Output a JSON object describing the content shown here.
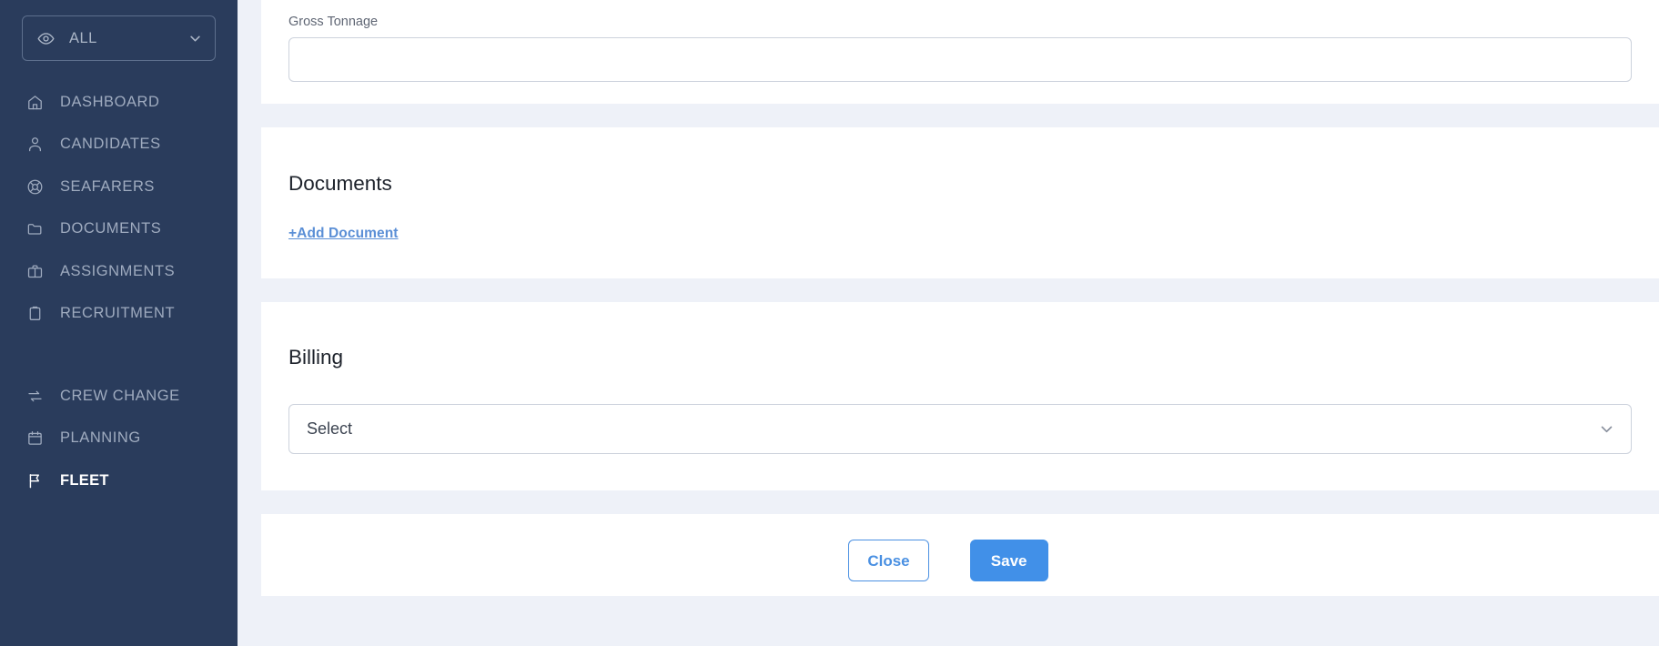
{
  "colors": {
    "sidebar_bg": "#2a3c5c",
    "page_bg": "#eef1f8",
    "card_bg": "#ffffff",
    "accent_blue": "#4190e8",
    "link_blue": "#5b8fd6",
    "sidebar_text": "#9fabbf",
    "sidebar_text_active": "#ffffff",
    "input_border": "#ccd2dc"
  },
  "sidebar": {
    "org_selector": {
      "icon": "eye-icon",
      "value": "ALL",
      "chevron": "chevron-down-icon"
    },
    "items": [
      {
        "label": "DASHBOARD",
        "icon": "home-icon",
        "active": false
      },
      {
        "label": "CANDIDATES",
        "icon": "user-icon",
        "active": false
      },
      {
        "label": "SEAFARERS",
        "icon": "lifebuoy-icon",
        "active": false
      },
      {
        "label": "DOCUMENTS",
        "icon": "folder-icon",
        "active": false
      },
      {
        "label": "ASSIGNMENTS",
        "icon": "briefcase-icon",
        "active": false
      },
      {
        "label": "RECRUITMENT",
        "icon": "clipboard-icon",
        "active": false
      },
      {
        "label": "CREW CHANGE",
        "icon": "exchange-icon",
        "active": false
      },
      {
        "label": "PLANNING",
        "icon": "calendar-icon",
        "active": false
      },
      {
        "label": "FLEET",
        "icon": "flag-icon",
        "active": true
      }
    ]
  },
  "main": {
    "particulars": {
      "gross_tonnage_label": "Gross Tonnage",
      "gross_tonnage_value": "",
      "gross_tonnage_placeholder": ""
    },
    "documents": {
      "title": "Documents",
      "add_link": "+Add Document"
    },
    "billing": {
      "title": "Billing",
      "select_value": "Select",
      "select_chevron": "chevron-down-icon"
    },
    "footer": {
      "close_label": "Close",
      "save_label": "Save"
    }
  }
}
